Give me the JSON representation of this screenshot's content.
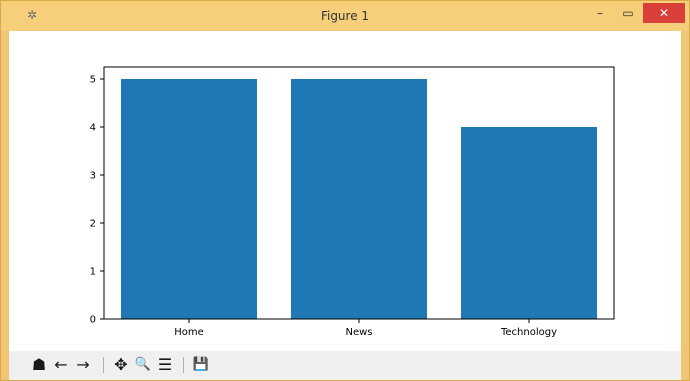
{
  "window": {
    "title": "Figure 1",
    "minimize_glyph": "–",
    "maximize_glyph": "▭",
    "close_glyph": "✕",
    "app_icon": "figure-app-icon"
  },
  "toolbar": {
    "home": "☗",
    "back": "←",
    "forward": "→",
    "pan": "✥",
    "zoom": "🔍",
    "configure": "☰",
    "save": "💾"
  },
  "chart_data": {
    "type": "bar",
    "categories": [
      "Home",
      "News",
      "Technology"
    ],
    "values": [
      5,
      5,
      4
    ],
    "title": "",
    "xlabel": "",
    "ylabel": "",
    "ylim": [
      0,
      5.25
    ],
    "yticks": [
      0,
      1,
      2,
      3,
      4,
      5
    ],
    "bar_color": "#1f77b4",
    "grid": false
  }
}
